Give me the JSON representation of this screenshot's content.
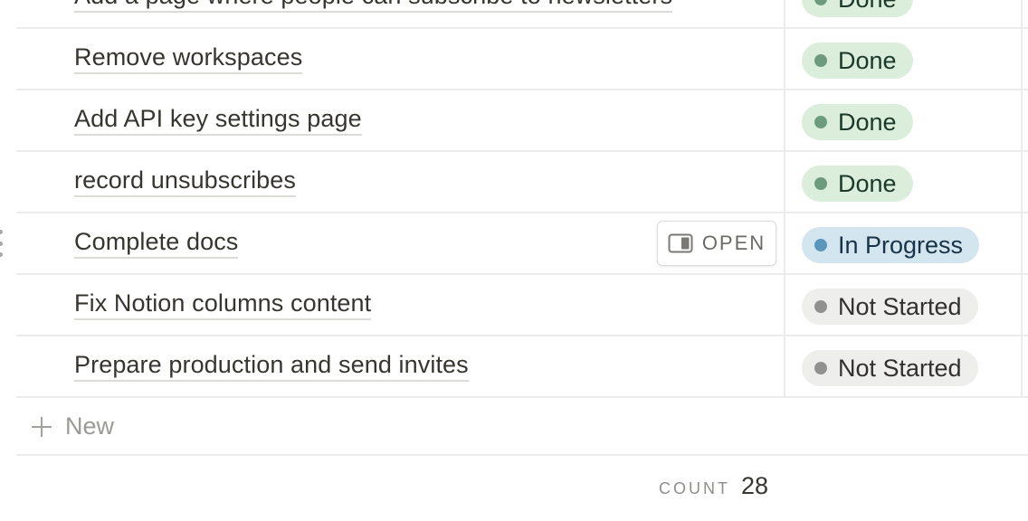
{
  "rows": [
    {
      "title": "Add a page where people can subscribe to newsletters",
      "status": "Done"
    },
    {
      "title": "Remove workspaces",
      "status": "Done"
    },
    {
      "title": "Add API key settings page",
      "status": "Done"
    },
    {
      "title": "record unsubscribes",
      "status": "Done"
    },
    {
      "title": "Complete docs",
      "status": "In Progress",
      "open_label": "OPEN"
    },
    {
      "title": "Fix Notion columns content",
      "status": "Not Started"
    },
    {
      "title": "Prepare production and send invites",
      "status": "Not Started"
    }
  ],
  "status_styles": {
    "Done": {
      "bg": "#dbeddb",
      "dot": "#6c9b7d",
      "text": "#1c3829"
    },
    "In Progress": {
      "bg": "#d3e5ef",
      "dot": "#5b97bd",
      "text": "#183347"
    },
    "Not Started": {
      "bg": "#eeeeed",
      "dot": "#91918e",
      "text": "#32302c"
    }
  },
  "new_row": {
    "label": "New",
    "icon": "plus-icon"
  },
  "footer": {
    "count_label": "COUNT",
    "count_value": "28"
  },
  "icons": {
    "open": "open-side-peek-icon",
    "drag": "drag-handle-icon"
  }
}
